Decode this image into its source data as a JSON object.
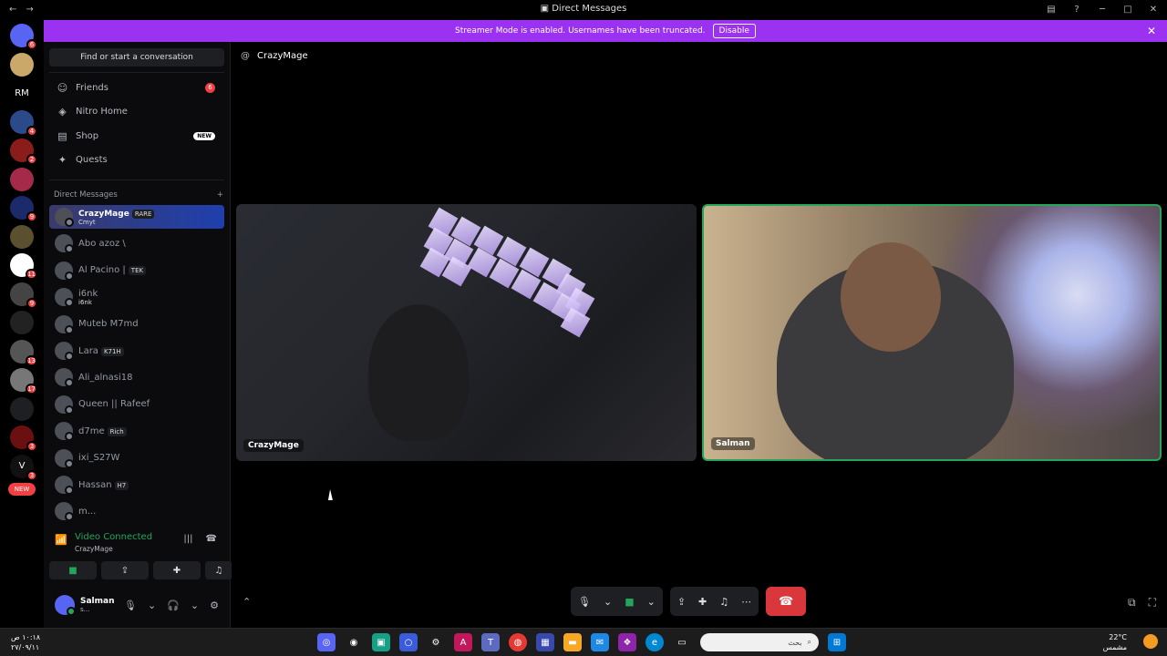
{
  "titlebar": {
    "title": "Direct Messages"
  },
  "banner": {
    "text": "Streamer Mode is enabled. Usernames have been truncated.",
    "disable_label": "Disable"
  },
  "guilds": [
    {
      "label": "",
      "badge": "6",
      "color": "#5865f2",
      "icon": "discord-logo-icon"
    },
    {
      "label": "",
      "badge": "",
      "color": "#c9a86a",
      "icon": "avatar-icon"
    },
    {
      "label": "RM",
      "badge": "",
      "color": "#000000",
      "icon": ""
    },
    {
      "label": "",
      "badge": "4",
      "color": "#2b4a8a",
      "icon": "server-icon"
    },
    {
      "label": "",
      "badge": "2",
      "color": "#8a1c1c",
      "icon": "server-icon"
    },
    {
      "label": "",
      "badge": "",
      "color": "#a52a4a",
      "icon": "server-icon"
    },
    {
      "label": "",
      "badge": "9",
      "color": "#1b2a6b",
      "icon": "server-icon"
    },
    {
      "label": "",
      "badge": "",
      "color": "#5a5030",
      "icon": "server-icon"
    },
    {
      "label": "",
      "badge": "11",
      "color": "#ffffff",
      "icon": "server-icon"
    },
    {
      "label": "",
      "badge": "9",
      "color": "#444444",
      "icon": "server-icon"
    },
    {
      "label": "",
      "badge": "",
      "color": "#222222",
      "icon": "server-icon"
    },
    {
      "label": "",
      "badge": "13",
      "color": "#555555",
      "icon": "server-icon"
    },
    {
      "label": "",
      "badge": "17",
      "color": "#777777",
      "icon": "server-icon"
    },
    {
      "label": "",
      "badge": "",
      "color": "#1e1f22",
      "icon": "folder-icon"
    },
    {
      "label": "",
      "badge": "3",
      "color": "#6b1010",
      "icon": "server-icon"
    },
    {
      "label": "V",
      "badge": "3",
      "color": "#111111",
      "icon": ""
    },
    {
      "label": "NEW",
      "badge": "",
      "color": "#f23f42",
      "icon": ""
    }
  ],
  "sidebar": {
    "search_label": "Find or start a conversation",
    "nav": [
      {
        "label": "Friends",
        "icon": "friends-icon",
        "badge": "6",
        "new": ""
      },
      {
        "label": "Nitro Home",
        "icon": "nitro-icon",
        "badge": "",
        "new": ""
      },
      {
        "label": "Shop",
        "icon": "shop-icon",
        "badge": "",
        "new": "NEW"
      },
      {
        "label": "Quests",
        "icon": "quests-icon",
        "badge": "",
        "new": ""
      }
    ],
    "dm_header": "Direct Messages",
    "dm_add": "+",
    "dms": [
      {
        "name": "CrazyMage",
        "tag": "RARE",
        "sub": "Cmyt",
        "active": true
      },
      {
        "name": "Abo azoz \\",
        "tag": "",
        "sub": "",
        "active": false
      },
      {
        "name": "Al Pacino |",
        "tag": "TEK",
        "sub": "",
        "active": false
      },
      {
        "name": "i6nk",
        "tag": "",
        "sub": "i6nk",
        "active": false
      },
      {
        "name": "Muteb M7md",
        "tag": "",
        "sub": "",
        "active": false
      },
      {
        "name": "Lara",
        "tag": "K71H",
        "sub": "",
        "active": false
      },
      {
        "name": "Ali_alnasi18",
        "tag": "",
        "sub": "",
        "active": false
      },
      {
        "name": "Queen || Rafeef",
        "tag": "",
        "sub": "",
        "active": false
      },
      {
        "name": "d7me",
        "tag": "Rich",
        "sub": "",
        "active": false
      },
      {
        "name": "ixi_S27W",
        "tag": "",
        "sub": "",
        "active": false
      },
      {
        "name": "Hassan",
        "tag": "H7",
        "sub": "",
        "active": false
      },
      {
        "name": "m...",
        "tag": "",
        "sub": "",
        "active": false
      }
    ],
    "voice": {
      "status": "Video Connected",
      "channel": "CrazyMage"
    },
    "user": {
      "name": "Salman",
      "status": "s..."
    }
  },
  "main": {
    "dm_title": "CrazyMage",
    "tiles": [
      {
        "label": "CrazyMage"
      },
      {
        "label": "Salman"
      }
    ]
  },
  "taskbar": {
    "time": "١٠:١٨ ص",
    "date": "٢٧/٠٩/١١",
    "temp": "22°C",
    "weather": "مشمس",
    "search_placeholder": "بحث",
    "weather_badge": "1"
  }
}
